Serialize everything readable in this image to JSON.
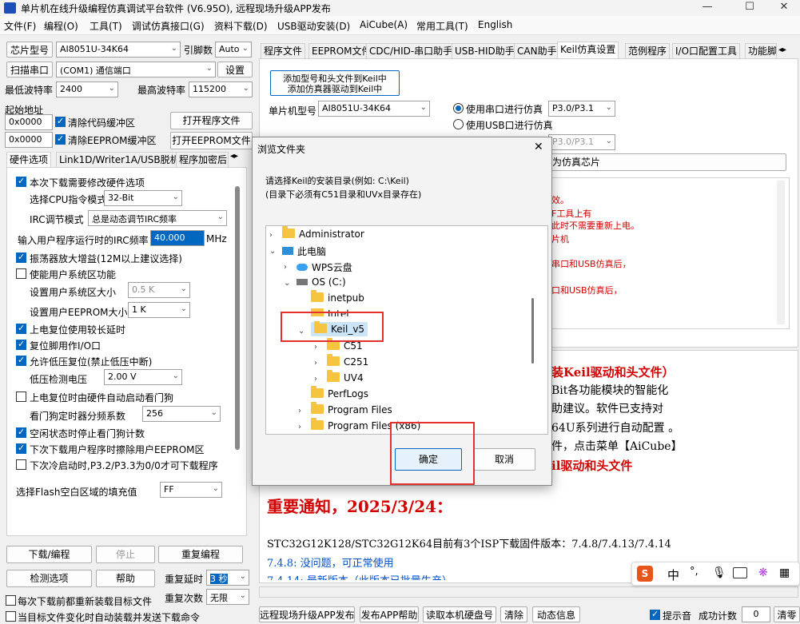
{
  "title": "单片机在线升级编程仿真调试平台软件 (V6.95O), 远程现场升级APP发布",
  "menu": [
    "文件(F)",
    "编程(O)",
    "工具(T)",
    "调试仿真接口(G)",
    "资料下载(D)",
    "USB驱动安装(D)",
    "AiCube(A)",
    "常用工具(T)",
    "English"
  ],
  "left": {
    "chip_label": "芯片型号",
    "chip_value": "AI8051U-34K64",
    "pins_label": "引脚数",
    "pins_value": "Auto",
    "scan_btn": "扫描串口",
    "port_value": "(COM1) 通信端口",
    "settings_btn": "设置",
    "min_baud_label": "最低波特率",
    "min_baud_value": "2400",
    "max_baud_label": "最高波特率",
    "max_baud_value": "115200",
    "start_addr_label": "起始地址",
    "addr1": "0x0000",
    "clear_code": "清除代码缓冲区",
    "open_prog": "打开程序文件",
    "addr2": "0x0000",
    "clear_eeprom": "清除EEPROM缓冲区",
    "open_eeprom": "打开EEPROM文件",
    "tabs": [
      "硬件选项",
      "Link1D/Writer1A/USB脱机",
      "程序加密后"
    ],
    "hw": {
      "need_modify": "本次下载需要修改硬件选项",
      "cpu_mode_label": "选择CPU指令模式",
      "cpu_mode": "32-Bit",
      "irc_mode_label": "IRC调节模式",
      "irc_mode": "总是动态调节IRC频率",
      "irc_freq_label": "输入用户程序运行时的IRC频率",
      "irc_freq": "40.000",
      "irc_unit": "MHz",
      "osc_gain": "振荡器放大增益(12M以上建议选择)",
      "sys_area": "使能用户系统区功能",
      "sys_size_label": "设置用户系统区大小",
      "sys_size": "0.5 K",
      "eeprom_size_label": "设置用户EEPROM大小",
      "eeprom_size": "1    K",
      "long_delay": "上电复位使用较长延时",
      "reset_io": "复位脚用作I/O口",
      "lvr": "允许低压复位(禁止低压中断)",
      "lvd_label": "低压检测电压",
      "lvd": "2.00 V",
      "wdt_auto": "上电复位时由硬件自动启动看门狗",
      "wdt_div_label": "看门狗定时器分频系数",
      "wdt_div": "256",
      "idle_stop_wdt": "空闲状态时停止看门狗计数",
      "erase_eeprom": "下次下载用户程序时擦除用户EEPROM区",
      "cold_boot": "下次冷启动时,P3.2/P3.3为0/0才可下载程序",
      "fill_label": "选择Flash空白区域的填充值",
      "fill": "FF"
    },
    "download_btn": "下载/编程",
    "stop_btn": "停止",
    "reprog_btn": "重复编程",
    "check_btn": "检测选项",
    "help_btn": "帮助",
    "delay_label": "重复延时",
    "delay_value": "3 秒",
    "count_label": "重复次数",
    "count_value": "无限",
    "reload_each": "每次下载前都重新装载目标文件",
    "auto_reload": "当目标文件变化时自动装载并发送下载命令"
  },
  "right": {
    "tabs": [
      "程序文件",
      "EEPROM文件",
      "CDC/HID-串口助手",
      "USB-HID助手",
      "CAN助手",
      "Keil仿真设置",
      "范例程序",
      "I/O口配置工具",
      "功能脚"
    ],
    "add_keil_btn_l1": "添加型号和头文件到Keil中",
    "add_keil_btn_l2": "添加仿真器驱动到Keil中",
    "mcu_label": "单片机型号",
    "mcu_value": "AI8051U-34K64",
    "serial_sim": "使用串口进行仿真",
    "serial_port": "P3.0/P3.1",
    "usb_sim": "使用USB口进行仿真",
    "port2": "P3.0/P3.1",
    "set_sim_btn": "为仿真芯片",
    "info_lines": [
      "效。",
      "F工具上有",
      "此时不需要重新上电。",
      "片机",
      "串口和USB仿真后，",
      "口和USB仿真后，"
    ],
    "big_lines": [
      "装Keil驱动和头文件）",
      "Bit各功能模块的智能化",
      "助建议。软件已支持对",
      "64U系列进行自动配置 。",
      "件，点击菜单【AiCube】",
      "il驱动和头文件"
    ],
    "notice_title": "重要通知，2025/3/24：",
    "notice_l1": "STC32G12K128/STC32G12K64目前有3个ISP下载固件版本：7.4.8/7.4.13/7.4.14",
    "notice_l2": "7.4.8:  没问题，可正常使用",
    "notice_l3": "7.4.14:  最新版本（此版本已批量生产）"
  },
  "bottom": {
    "remote_btn": "远程现场升级APP发布",
    "publish_help": "发布APP帮助",
    "read_disk": "读取本机硬盘号",
    "clear": "清除",
    "dynamic": "动态信息",
    "beep": "提示音",
    "success_label": "成功计数",
    "success_value": "0",
    "clear2": "清零"
  },
  "dialog": {
    "title": "浏览文件夹",
    "line1": "请选择Keil的安装目录(例如: C:\\Keil)",
    "line2": "(目录下必须有C51目录和UVx目录存在)",
    "tree": [
      "Administrator",
      "此电脑",
      "WPS云盘",
      "OS (C:)",
      "inetpub",
      "Intel",
      "Keil_v5",
      "C51",
      "C251",
      "UV4",
      "PerfLogs",
      "Program Files",
      "Program Files (x86)"
    ],
    "ok": "确定",
    "cancel": "取消"
  },
  "ime": [
    "中",
    "°,"
  ]
}
